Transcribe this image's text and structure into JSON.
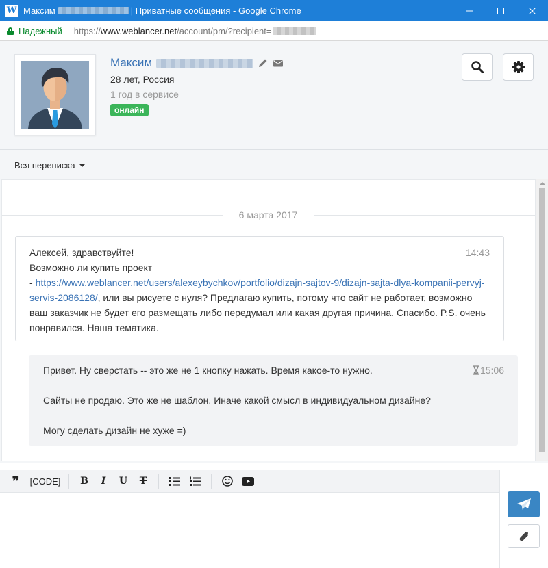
{
  "window": {
    "title_prefix": "Максим",
    "title_suffix": "| Приватные сообщения - Google Chrome"
  },
  "addressbar": {
    "secure_label": "Надежный",
    "url_scheme": "https://",
    "url_host": "www.weblancer.net",
    "url_path": "/account/pm/?recipient="
  },
  "profile": {
    "first_name": "Максим",
    "age_location": "28 лет, Россия",
    "tenure": "1 год в сервисе",
    "status": "онлайн"
  },
  "filter": {
    "label": "Вся переписка"
  },
  "conversation": {
    "date": "6 марта 2017",
    "messages": [
      {
        "time": "14:43",
        "line1": "Алексей, здравствуйте!",
        "line2": "Возможно ли купить проект",
        "link_prefix": "- ",
        "link": "https://www.weblancer.net/users/alexeybychkov/portfolio/dizajn-sajtov-9/dizajn-sajta-dlya-kompanii-pervyj-servis-2086128/",
        "after_link": ", или вы рисуете с нуля? Предлагаю купить, потому что сайт не работает, возможно ваш заказчик не будет его размещать либо передумал или какая другая причина. Спасибо. P.S. очень понравился. Наша тематика."
      },
      {
        "time": "15:06",
        "line1": "Привет. Ну сверстать -- это же не 1 кнопку нажать. Время какое-то нужно.",
        "line2": "Сайты не продаю. Это же не шаблон. Иначе какой смысл в индивидуальном дизайне?",
        "line3": "Могу сделать дизайн не хуже =)"
      }
    ]
  },
  "composer": {
    "quote_label": "❞",
    "code_label": "[CODE]",
    "bold_label": "B",
    "italic_label": "I",
    "underline_label": "U",
    "strike_label": "T"
  },
  "colors": {
    "titlebar": "#1e7fd8",
    "link": "#3a73b5",
    "online_badge": "#3bb55a",
    "send_button": "#3a86c4"
  }
}
